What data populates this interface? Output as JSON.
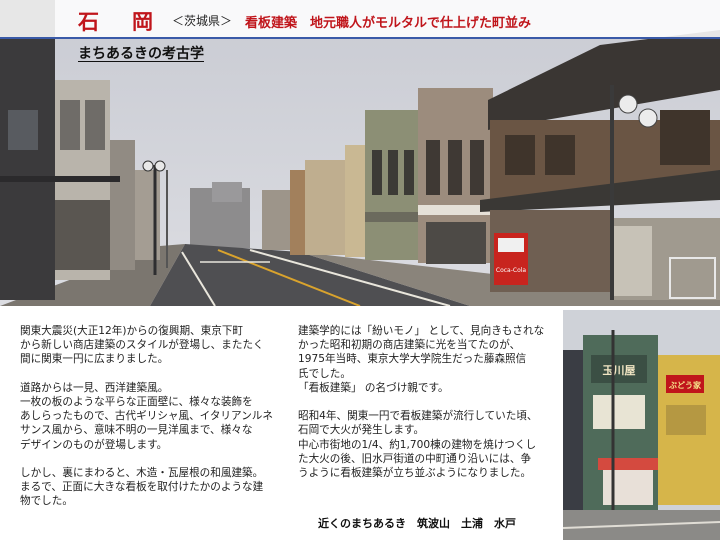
{
  "header": {
    "city": "石　岡",
    "prefecture": "＜茨城県＞",
    "headline": "看板建築　地元職人がモルタルで仕上げた町並み",
    "series": "まちあるきの考古学"
  },
  "photos": {
    "main": {
      "vending_machine_text": "Coca-Cola"
    },
    "side": {
      "sign_left": "玉川屋",
      "sign_right": "ぶどう家"
    }
  },
  "body": {
    "column1": "関東大震災(大正12年)からの復興期、東京下町\nから新しい商店建築のスタイルが登場し、またたく\n間に関東一円に広まりました。\n\n道路からは一見、西洋建築風。\n一枚の板のような平らな正面壁に、様々な装飾を\nあしらったもので、古代ギリシャ風、イタリアンルネ\nサンス風から、意味不明の一見洋風まで、様々な\nデザインのものが登場します。\n\nしかし、裏にまわると、木造・瓦屋根の和風建築。\nまるで、正面に大きな看板を取付けたかのような建\n物でした。",
    "column2": "建築学的には「紛いモノ」 として、見向きもされな\nかった昭和初期の商店建築に光を当てたのが、\n1975年当時、東京大学大学院生だった藤森照信\n氏でした。\n「看板建築」 の名づけ親です。\n\n昭和4年、関東一円で看板建築が流行していた頃、\n石岡で大火が発生します。\n中心市街地の1/4、約1,700棟の建物を焼けつくし\nた大火の後、旧水戸街道の中町通り沿いには、争\nうように看板建築が立ち並ぶようになりました。"
  },
  "footer": {
    "label": "近くのまちあるき　筑波山　土浦　水戸"
  },
  "colors": {
    "accent_red": "#c0151b",
    "rule_blue": "#3a5aa8"
  }
}
